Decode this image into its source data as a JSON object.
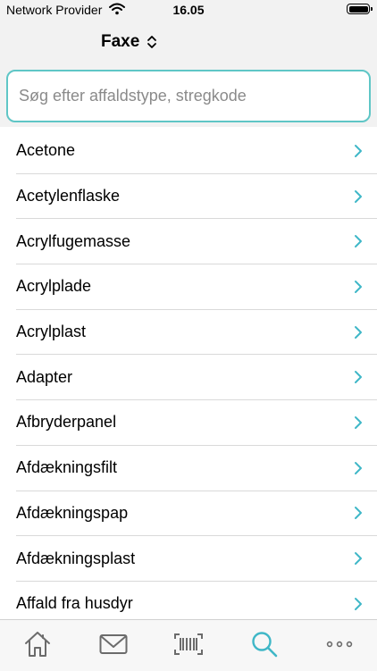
{
  "status": {
    "carrier": "Network Provider",
    "time": "16.05"
  },
  "location": {
    "name": "Faxe",
    "icon": "chevron-up-down-icon"
  },
  "search": {
    "placeholder": "Søg efter affaldstype, stregkode",
    "value": ""
  },
  "items": [
    "Acetone",
    "Acetylenflaske",
    "Acrylfugemasse",
    "Acrylplade",
    "Acrylplast",
    "Adapter",
    "Afbryderpanel",
    "Afdækningsfilt",
    "Afdækningspap",
    "Afdækningsplast",
    "Affald fra husdyr"
  ],
  "tabs": [
    {
      "icon": "home-icon",
      "active": false
    },
    {
      "icon": "mail-icon",
      "active": false
    },
    {
      "icon": "barcode-icon",
      "active": false
    },
    {
      "icon": "search-icon",
      "active": true
    },
    {
      "icon": "more-icon",
      "active": false
    }
  ],
  "colors": {
    "accent": "#3fb7c7",
    "inactive": "#6b6b6b",
    "search_border": "#5fc6c6"
  }
}
